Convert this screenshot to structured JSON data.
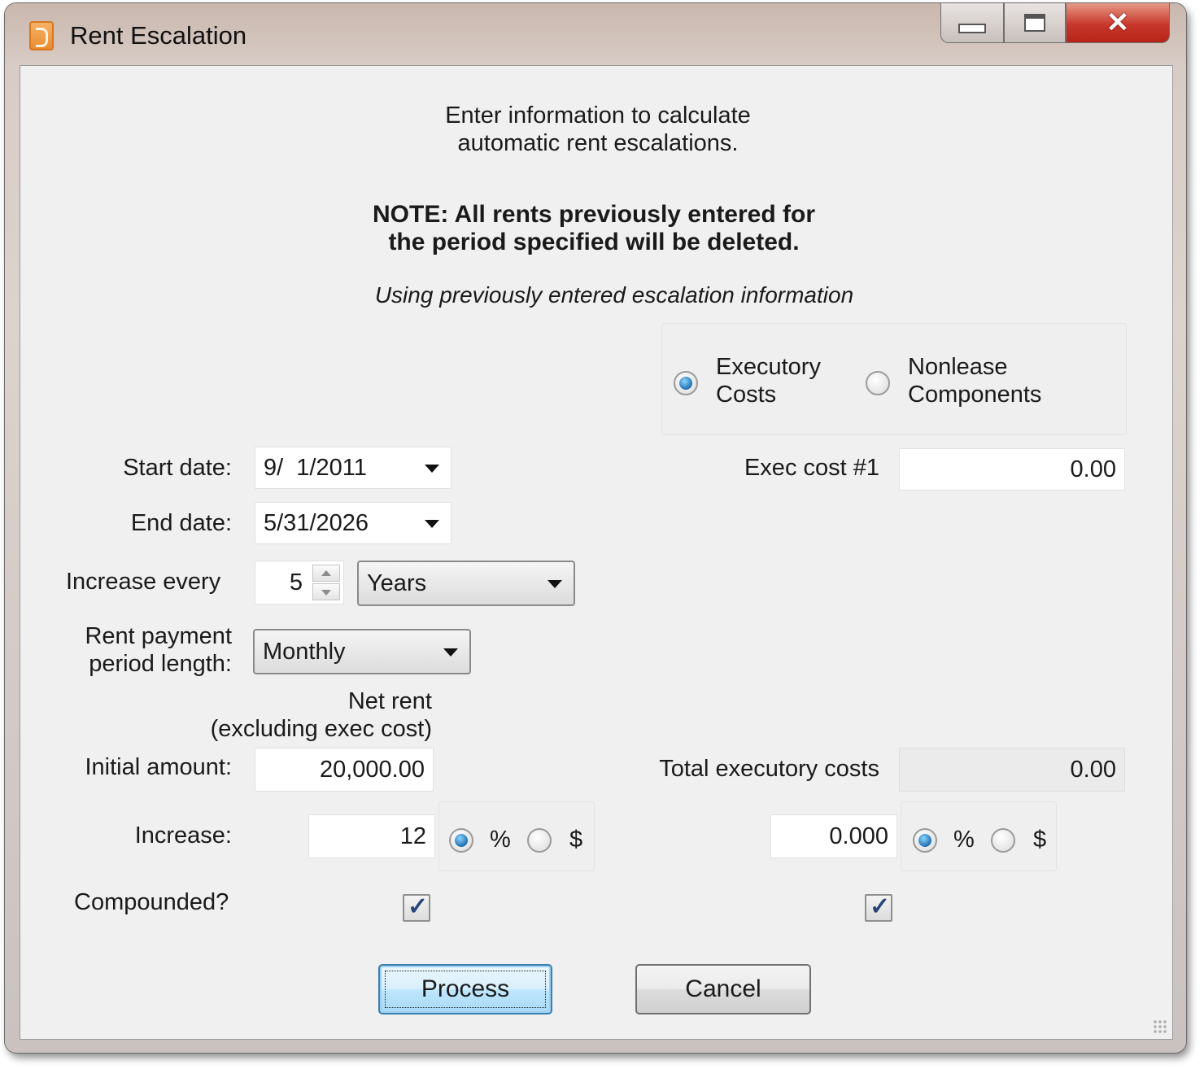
{
  "window": {
    "title": "Rent Escalation",
    "icon": "app-icon"
  },
  "header": {
    "intro_line1": "Enter information to calculate",
    "intro_line2": "automatic rent escalations.",
    "note_line1": "NOTE: All rents previously entered for",
    "note_line2": "the period specified will be deleted.",
    "status": "Using previously entered escalation information"
  },
  "cost_type": {
    "options": [
      {
        "label_line1": "Executory",
        "label_line2": "Costs",
        "selected": true
      },
      {
        "label_line1": "Nonlease",
        "label_line2": "Components",
        "selected": false
      }
    ]
  },
  "form": {
    "start_date_label": "Start date:",
    "start_date_value": "9/  1/2011",
    "end_date_label": "End date:",
    "end_date_value": "5/31/2026",
    "increase_every_label": "Increase every",
    "increase_every_value": "5",
    "increase_unit": "Years",
    "payment_period_label_line1": "Rent payment",
    "payment_period_label_line2": "period length:",
    "payment_period_value": "Monthly",
    "net_rent_header_line1": "Net rent",
    "net_rent_header_line2": "(excluding exec cost)",
    "initial_amount_label": "Initial amount:",
    "initial_amount_value": "20,000.00",
    "increase_label": "Increase:",
    "increase_value": "12",
    "increase_percent_label": "%",
    "increase_dollar_label": "$",
    "compounded_label": "Compounded?"
  },
  "exec": {
    "exec_cost_label": "Exec cost #1",
    "exec_cost_value": "0.00",
    "total_label": "Total executory costs",
    "total_value": "0.00",
    "increase_value": "0.000",
    "percent_label": "%",
    "dollar_label": "$"
  },
  "buttons": {
    "process": "Process",
    "cancel": "Cancel"
  }
}
